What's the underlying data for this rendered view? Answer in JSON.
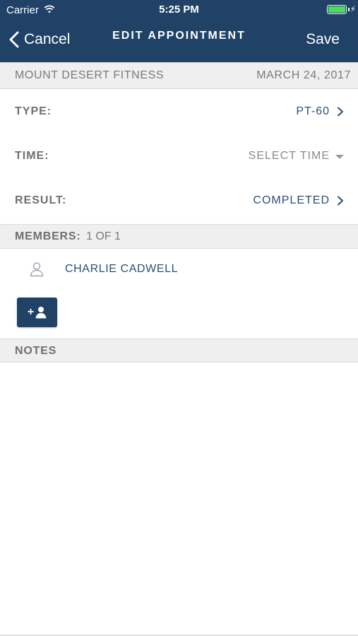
{
  "status_bar": {
    "carrier": "Carrier",
    "time": "5:25 PM",
    "battery_level": 1.0
  },
  "nav": {
    "cancel_label": "Cancel",
    "title": "EDIT APPOINTMENT",
    "save_label": "Save",
    "bar_color": "#1f4266"
  },
  "header": {
    "location": "MOUNT DESERT FITNESS",
    "date": "MARCH 24, 2017"
  },
  "fields": {
    "type": {
      "label": "TYPE:",
      "value": "PT-60"
    },
    "time": {
      "label": "TIME:",
      "value": "SELECT TIME"
    },
    "result": {
      "label": "RESULT:",
      "value": "COMPLETED"
    }
  },
  "members": {
    "label": "MEMBERS:",
    "count": "1 OF 1",
    "items": [
      {
        "name": "CHARLIE CADWELL",
        "icon": "person-outline-icon"
      }
    ],
    "add_button_icon": "add-member-icon"
  },
  "notes": {
    "label": "NOTES"
  },
  "colors": {
    "accent": "#2a4f72",
    "section_bg": "#efefef",
    "battery": "#4cd964"
  }
}
